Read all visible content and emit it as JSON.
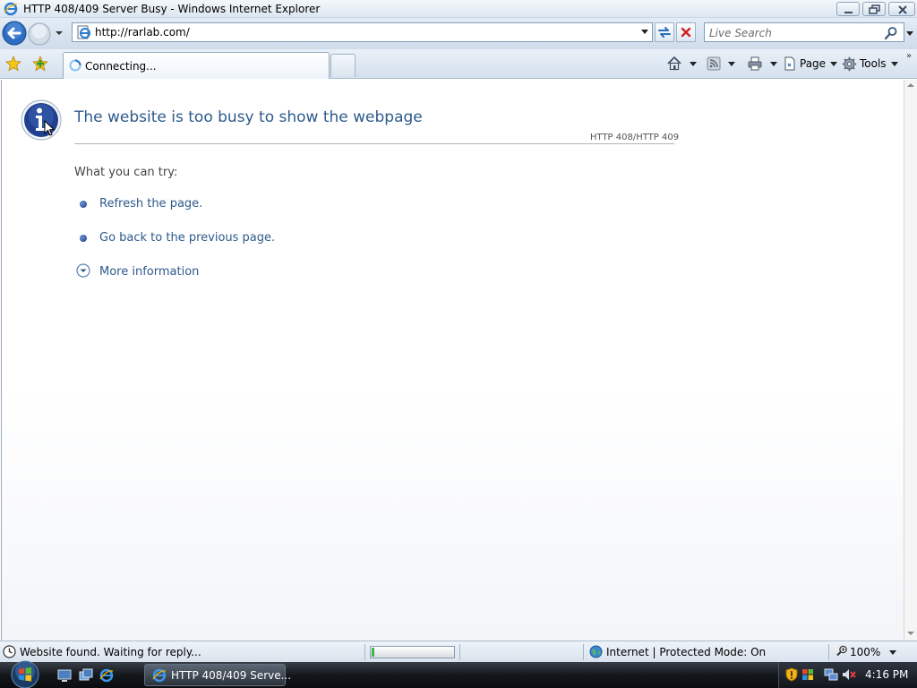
{
  "window": {
    "title": "HTTP 408/409 Server Busy - Windows Internet Explorer"
  },
  "navbar": {
    "address": "http://rarlab.com/",
    "search_placeholder": "Live Search"
  },
  "tabs": [
    {
      "label": "Connecting..."
    }
  ],
  "commands": {
    "page_label": "Page",
    "tools_label": "Tools"
  },
  "page": {
    "heading": "The website is too busy to show the webpage",
    "error_code": "HTTP 408/HTTP 409",
    "try_label": "What you can try:",
    "options": [
      {
        "label": "Refresh the page."
      },
      {
        "label": "Go back to the previous page."
      }
    ],
    "more_info": "More information"
  },
  "statusbar": {
    "status": "Website found. Waiting for reply...",
    "progress": 0.03,
    "zone": "Internet | Protected Mode: On",
    "zoom": "100%"
  },
  "taskbar": {
    "active_window": "HTTP 408/409 Serve...",
    "clock": "4:16 PM"
  },
  "colors": {
    "link": "#2e5a8c",
    "info_icon": "#1f3f8f",
    "progress_fill": "#3fb64a"
  }
}
